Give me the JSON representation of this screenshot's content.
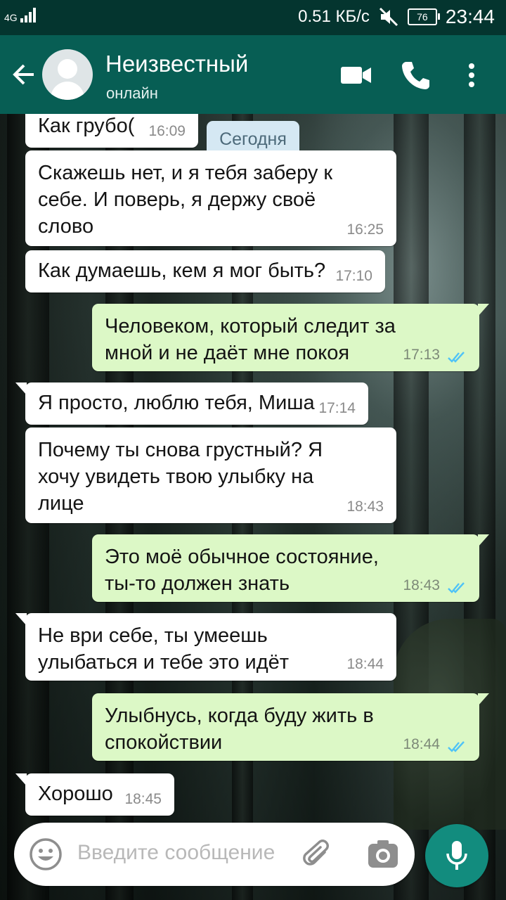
{
  "status_bar": {
    "network": "4G",
    "speed": "0.51 КБ/с",
    "battery": "76",
    "time": "23:44"
  },
  "header": {
    "contact_name": "Неизвестный",
    "contact_status": "онлайн",
    "icons": [
      "back-arrow-icon",
      "avatar",
      "video-call-icon",
      "phone-icon",
      "more-vert-icon"
    ]
  },
  "chat": {
    "date_chip": "Сегодня",
    "messages": [
      {
        "dir": "in",
        "text": "Как грубо(",
        "time": "16:09"
      },
      {
        "dir": "in",
        "text": "Скажешь нет, и я тебя заберу к\nсебе. И поверь, я держу своё\nслово",
        "time": "16:25"
      },
      {
        "dir": "in",
        "text": "Как думаешь, кем я мог быть?",
        "time": "17:10"
      },
      {
        "dir": "out",
        "text": "Человеком, который следит за\nмной и не даёт мне покоя",
        "time": "17:13",
        "status": "read"
      },
      {
        "dir": "in",
        "text": "Я просто, люблю тебя, Миша",
        "time": "17:14"
      },
      {
        "dir": "in",
        "text": "Почему ты снова грустный? Я\nхочу увидеть твою улыбку на\nлице",
        "time": "18:43"
      },
      {
        "dir": "out",
        "text": "Это моё обычное состояние,\nты-то должен знать",
        "time": "18:43",
        "status": "read"
      },
      {
        "dir": "in",
        "text": "Не ври себе, ты умеешь\nулыбаться и тебе это идёт",
        "time": "18:44"
      },
      {
        "dir": "out",
        "text": "Улыбнусь, когда буду жить в\nспокойствии",
        "time": "18:44",
        "status": "read"
      },
      {
        "dir": "in",
        "text": "Хорошо",
        "time": "18:45"
      }
    ]
  },
  "composer": {
    "placeholder": "Введите сообщение"
  },
  "colors": {
    "status_bar": "#04352f",
    "app_bar": "#075e54",
    "incoming_bubble": "#ffffff",
    "outgoing_bubble": "#dcf8c6",
    "read_ticks": "#4fc3f7",
    "mic_button": "#128c7e"
  }
}
